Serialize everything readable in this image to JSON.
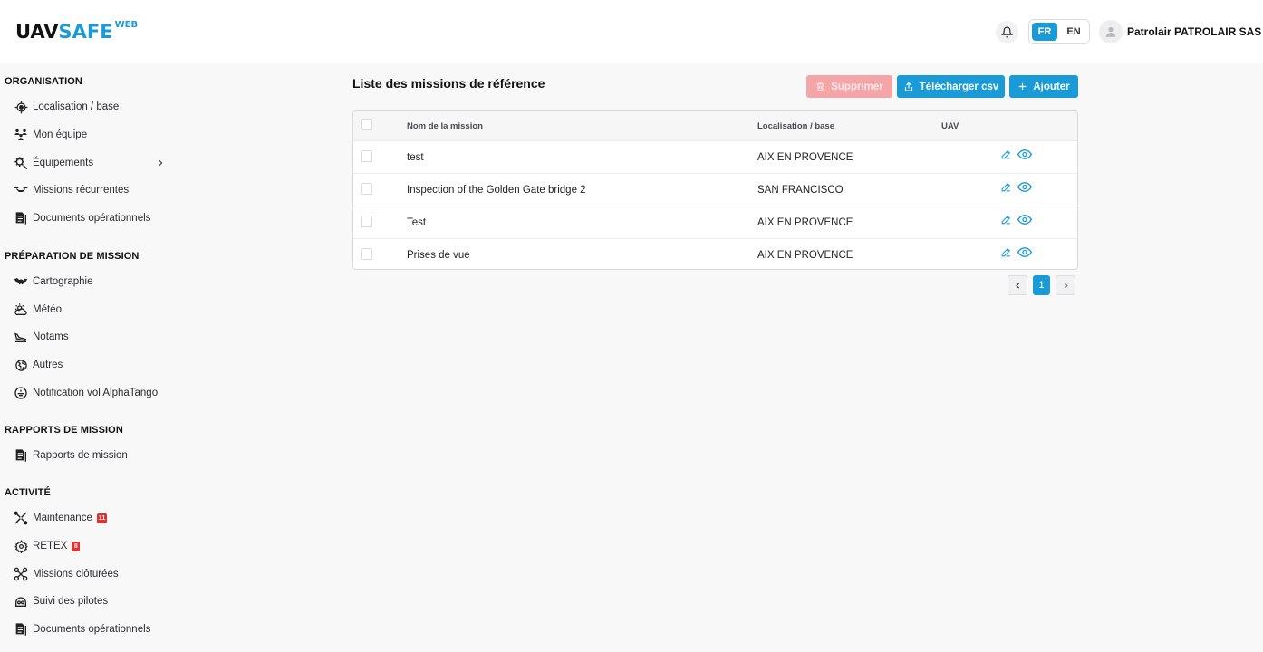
{
  "header": {
    "logo_part1": "UAV",
    "logo_part2": "SAFE",
    "logo_suffix": "WEB",
    "lang_fr": "FR",
    "lang_en": "EN",
    "user_name": "Patrolair PATROLAIR SAS"
  },
  "sidebar": {
    "sections": [
      {
        "title": "ORGANISATION",
        "items": [
          {
            "label": "Localisation / base",
            "icon": "target-icon"
          },
          {
            "label": "Mon équipe",
            "icon": "team-icon"
          },
          {
            "label": "Équipements",
            "icon": "gear-search-icon"
          },
          {
            "label": "Missions récurrentes",
            "icon": "drone-icon"
          },
          {
            "label": "Documents opérationnels",
            "icon": "document-icon"
          }
        ]
      },
      {
        "title": "PRÉPARATION DE MISSION",
        "items": [
          {
            "label": "Cartographie",
            "icon": "map-icon"
          },
          {
            "label": "Météo",
            "icon": "weather-icon"
          },
          {
            "label": "Notams",
            "icon": "landing-icon"
          },
          {
            "label": "Autres",
            "icon": "globe-icon"
          },
          {
            "label": "Notification vol AlphaTango",
            "icon": "drone-notify-icon"
          }
        ]
      },
      {
        "title": "RAPPORTS DE MISSION",
        "items": [
          {
            "label": "Rapports de mission",
            "icon": "document-icon"
          }
        ]
      },
      {
        "title": "ACTIVITÉ",
        "items": [
          {
            "label": "Maintenance",
            "icon": "tools-icon",
            "badge": "11"
          },
          {
            "label": "RETEX",
            "icon": "cog-icon",
            "badge": "8"
          },
          {
            "label": "Missions clôturées",
            "icon": "drone-icon"
          },
          {
            "label": "Suivi des pilotes",
            "icon": "pilot-icon"
          },
          {
            "label": "Documents opérationnels",
            "icon": "document-icon"
          }
        ]
      }
    ]
  },
  "main": {
    "title": "Liste des missions de référence",
    "buttons": {
      "delete": "Supprimer",
      "csv": "Télécharger csv",
      "add": "Ajouter"
    },
    "table": {
      "headers": [
        "Nom de la mission",
        "Localisation / base",
        "UAV"
      ],
      "rows": [
        {
          "name": "test",
          "location": "AIX EN PROVENCE",
          "uav": ""
        },
        {
          "name": "Inspection of the Golden Gate bridge 2",
          "location": "SAN FRANCISCO",
          "uav": ""
        },
        {
          "name": "Test",
          "location": "AIX EN PROVENCE",
          "uav": ""
        },
        {
          "name": "Prises de vue",
          "location": "AIX EN PROVENCE",
          "uav": ""
        }
      ]
    },
    "pagination": {
      "current_page": "1"
    }
  },
  "colors": {
    "accent": "#1a9ad6",
    "danger_disabled": "#f4a5a8",
    "badge": "#e0322f"
  }
}
